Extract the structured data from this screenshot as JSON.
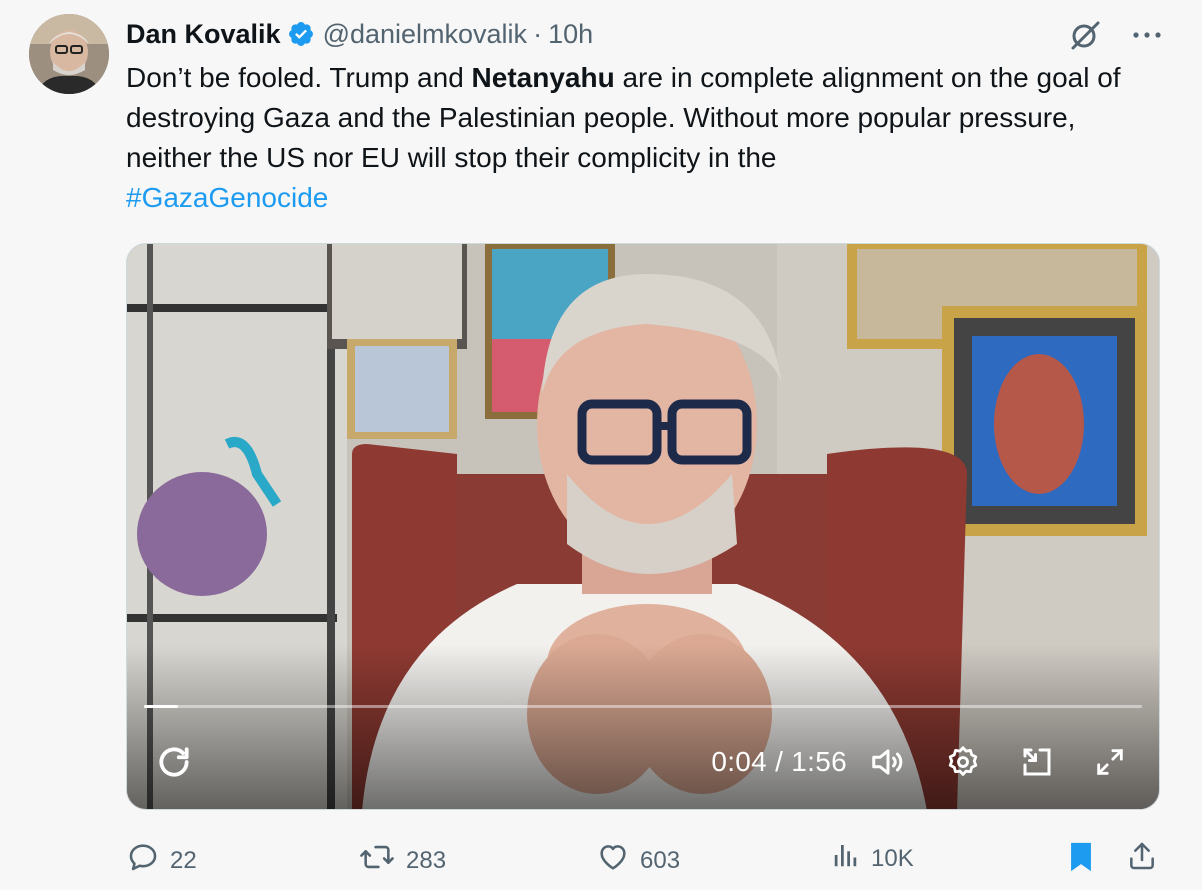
{
  "author": {
    "name": "Dan Kovalik",
    "handle": "@danielmkovalik",
    "separator": "·",
    "time": "10h"
  },
  "tweet": {
    "text_1": "Don’t be fooled.  Trump and ",
    "bold": "Netanyahu",
    "text_2": " are in complete alignment on the goal of destroying Gaza and the Palestinian people.  Without more popular pressure, neither the US nor EU will stop their complicity in the ",
    "hashtag": "#GazaGenocide"
  },
  "video": {
    "time_display": "0:04 / 1:56",
    "progress": 0.034
  },
  "actions": {
    "replies": "22",
    "reposts": "283",
    "likes": "603",
    "views": "10K"
  },
  "colors": {
    "accent": "#1d9bf0",
    "secondary_text": "#536471",
    "background": "#f7f7f7"
  },
  "icons": [
    "grok-icon",
    "more-icon",
    "verified-badge-icon",
    "replay-icon",
    "volume-icon",
    "settings-icon",
    "pip-icon",
    "fullscreen-icon",
    "reply-icon",
    "repost-icon",
    "like-icon",
    "views-icon",
    "bookmark-icon",
    "share-icon"
  ]
}
